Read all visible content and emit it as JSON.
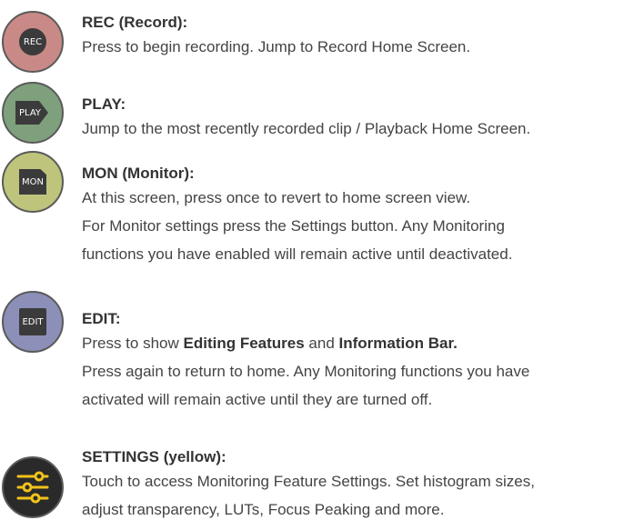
{
  "buttons": {
    "rec": {
      "icon_text": "REC",
      "title": "REC (Record):",
      "lines": [
        "Press to begin recording. Jump to Record Home Screen."
      ],
      "color": "#c98a87"
    },
    "play": {
      "icon_text": "PLAY",
      "title": "PLAY:",
      "lines": [
        "Jump to the most recently recorded clip / Playback Home Screen."
      ],
      "color": "#7fa07c"
    },
    "mon": {
      "icon_text": "MON",
      "title": "MON (Monitor):",
      "lines": [
        "At this screen, press once to revert to home screen view.",
        "For Monitor settings press the Settings button. Any Monitoring",
        "functions you have enabled will remain active until deactivated."
      ],
      "color": "#bfc47c"
    },
    "edit": {
      "icon_text": "EDIT",
      "title": "EDIT:",
      "line1_parts": [
        "Press to show ",
        "Editing Features",
        " and ",
        "Information Bar."
      ],
      "lines": [
        "Press again to return to home. Any Monitoring functions you have",
        "activated will remain active until they are turned off."
      ],
      "color": "#8c8fb8"
    },
    "settings": {
      "title": "SETTINGS (yellow):",
      "lines": [
        "Touch to access Monitoring Feature Settings. Set histogram sizes,",
        "adjust transparency, LUTs, Focus Peaking and more."
      ],
      "color": "#2a2a2a",
      "accent": "#f2c21a"
    }
  }
}
